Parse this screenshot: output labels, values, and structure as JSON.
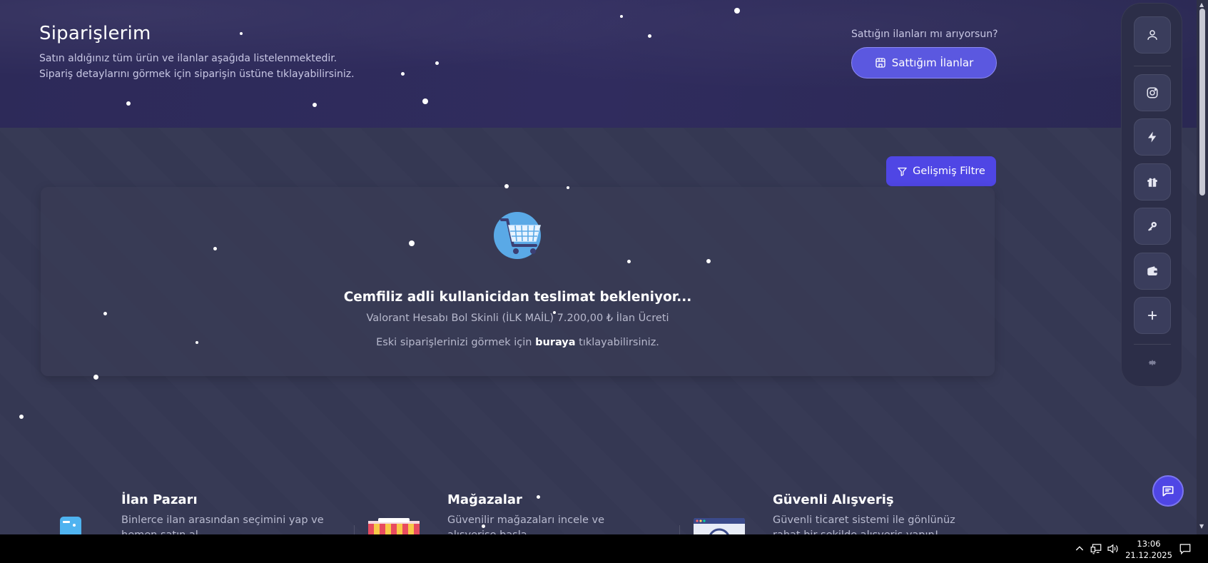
{
  "header": {
    "title": "Siparişlerim",
    "desc_line1": "Satın aldığınız tüm ürün ve ilanlar aşağıda listelenmektedir.",
    "desc_line2": "Sipariş detaylarını görmek için siparişin üstüne tıklayabilirsiniz.",
    "sell_question": "Sattığın ilanları mı arıyorsun?",
    "sell_button": "Sattığım İlanlar"
  },
  "filter": {
    "label": "Gelişmiş Filtre"
  },
  "order": {
    "title": "Cemfiliz adli kullanicidan teslimat bekleniyor...",
    "subtitle": "Valorant Hesabı Bol Skinli (İLK MAİL) 7.200,00 ₺ İlan Ücreti",
    "old_prefix": "Eski siparişlerinizi görmek için",
    "old_link": "buraya",
    "old_suffix": "tıklayabilirsiniz."
  },
  "features": [
    {
      "title": "İlan Pazarı",
      "desc": "Binlerce ilan arasından seçimini yap ve hemen satın al."
    },
    {
      "title": "Mağazalar",
      "desc": "Güvenilir mağazaları incele ve alışverişe başla."
    },
    {
      "title": "Güvenli Alışveriş",
      "desc": "Güvenli ticaret sistemi ile gönlünüz rahat bir şekilde alışveriş yapın!"
    }
  ],
  "sidebar": {
    "icons": [
      "user-icon",
      "instagram-icon",
      "lightning-icon",
      "gift-icon",
      "key-icon",
      "wallet-icon",
      "plus-icon",
      "gear-icon"
    ]
  },
  "taskbar": {
    "time": "13:06",
    "date": "21.12.2025"
  },
  "colors": {
    "accent": "#4f46e5",
    "hero_bg": "#2d2a59",
    "page_bg": "#353853"
  }
}
